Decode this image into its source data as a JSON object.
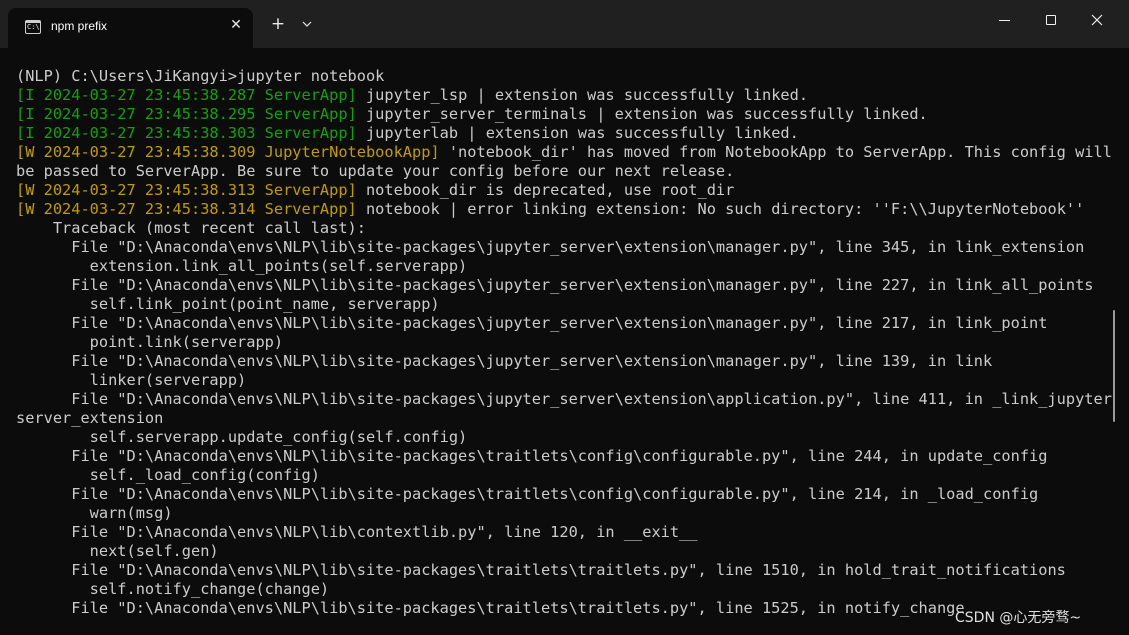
{
  "window": {
    "tab_title": "npm prefix",
    "tab_icon": "terminal-icon",
    "new_tab_symbol": "+",
    "dropdown_symbol": "⌄",
    "close_tab_symbol": "✕"
  },
  "colors": {
    "background": "#0c0c0c",
    "titlebar": "#202020",
    "text": "#cccccc",
    "info_green": "#13a10e",
    "warn_yellow": "#c19c00"
  },
  "terminal": {
    "lines": [
      {
        "plain": "(NLP) C:\\Users\\JiKangyi>jupyter notebook"
      },
      {
        "prefix": "[I 2024-03-27 23:45:38.287 ServerApp]",
        "tone": "green",
        "rest": " jupyter_lsp | extension was successfully linked."
      },
      {
        "prefix": "[I 2024-03-27 23:45:38.295 ServerApp]",
        "tone": "green",
        "rest": " jupyter_server_terminals | extension was successfully linked."
      },
      {
        "prefix": "[I 2024-03-27 23:45:38.303 ServerApp]",
        "tone": "green",
        "rest": " jupyterlab | extension was successfully linked."
      },
      {
        "prefix": "[W 2024-03-27 23:45:38.309 JupyterNotebookApp]",
        "tone": "yellow",
        "rest": " 'notebook_dir' has moved from NotebookApp to ServerApp. This config will"
      },
      {
        "plain": "be passed to ServerApp. Be sure to update your config before our next release."
      },
      {
        "prefix": "[W 2024-03-27 23:45:38.313 ServerApp]",
        "tone": "yellow",
        "rest": " notebook_dir is deprecated, use root_dir"
      },
      {
        "prefix": "[W 2024-03-27 23:45:38.314 ServerApp]",
        "tone": "yellow",
        "rest": " notebook | error linking extension: No such directory: ''F:\\\\JupyterNotebook''"
      },
      {
        "plain": "    Traceback (most recent call last):"
      },
      {
        "plain": "      File \"D:\\Anaconda\\envs\\NLP\\lib\\site-packages\\jupyter_server\\extension\\manager.py\", line 345, in link_extension"
      },
      {
        "plain": "        extension.link_all_points(self.serverapp)"
      },
      {
        "plain": "      File \"D:\\Anaconda\\envs\\NLP\\lib\\site-packages\\jupyter_server\\extension\\manager.py\", line 227, in link_all_points"
      },
      {
        "plain": "        self.link_point(point_name, serverapp)"
      },
      {
        "plain": "      File \"D:\\Anaconda\\envs\\NLP\\lib\\site-packages\\jupyter_server\\extension\\manager.py\", line 217, in link_point"
      },
      {
        "plain": "        point.link(serverapp)"
      },
      {
        "plain": "      File \"D:\\Anaconda\\envs\\NLP\\lib\\site-packages\\jupyter_server\\extension\\manager.py\", line 139, in link"
      },
      {
        "plain": "        linker(serverapp)"
      },
      {
        "plain": "      File \"D:\\Anaconda\\envs\\NLP\\lib\\site-packages\\jupyter_server\\extension\\application.py\", line 411, in _link_jupyter_"
      },
      {
        "plain": "server_extension"
      },
      {
        "plain": "        self.serverapp.update_config(self.config)"
      },
      {
        "plain": "      File \"D:\\Anaconda\\envs\\NLP\\lib\\site-packages\\traitlets\\config\\configurable.py\", line 244, in update_config"
      },
      {
        "plain": "        self._load_config(config)"
      },
      {
        "plain": "      File \"D:\\Anaconda\\envs\\NLP\\lib\\site-packages\\traitlets\\config\\configurable.py\", line 214, in _load_config"
      },
      {
        "plain": "        warn(msg)"
      },
      {
        "plain": "      File \"D:\\Anaconda\\envs\\NLP\\lib\\contextlib.py\", line 120, in __exit__"
      },
      {
        "plain": "        next(self.gen)"
      },
      {
        "plain": "      File \"D:\\Anaconda\\envs\\NLP\\lib\\site-packages\\traitlets\\traitlets.py\", line 1510, in hold_trait_notifications"
      },
      {
        "plain": "        self.notify_change(change)"
      },
      {
        "plain": "      File \"D:\\Anaconda\\envs\\NLP\\lib\\site-packages\\traitlets\\traitlets.py\", line 1525, in notify_change"
      }
    ]
  },
  "watermark": "CSDN @心无旁骛~"
}
